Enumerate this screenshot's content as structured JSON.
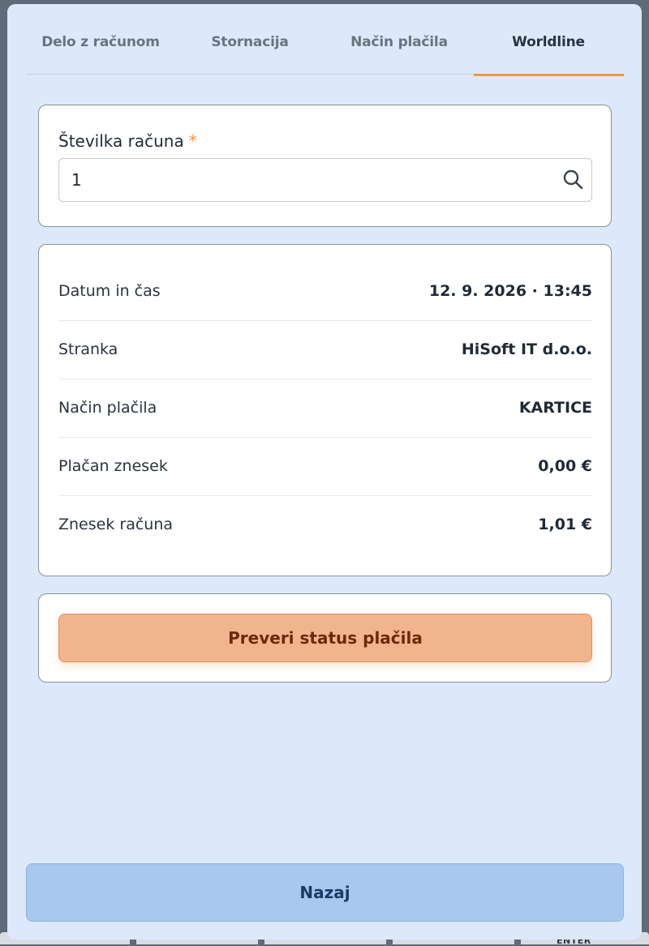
{
  "tabs": [
    {
      "label": "Delo z računom"
    },
    {
      "label": "Stornacija"
    },
    {
      "label": "Način plačila"
    },
    {
      "label": "Worldline"
    }
  ],
  "invoice_field": {
    "label": "Številka računa",
    "required_mark": "*",
    "value": "1",
    "icon": "search-icon"
  },
  "details": [
    {
      "label": "Datum in čas",
      "value": "12. 9. 2026 · 13:45"
    },
    {
      "label": "Stranka",
      "value": "HiSoft IT d.o.o."
    },
    {
      "label": "Način plačila",
      "value": "KARTICE"
    },
    {
      "label": "Plačan znesek",
      "value": "0,00 €"
    },
    {
      "label": "Znesek računa",
      "value": "1,01 €"
    }
  ],
  "actions": {
    "check_status_label": "Preveri status plačila",
    "back_label": "Nazaj"
  },
  "background_keyboard": {
    "enter_label": "ENTER"
  },
  "colors": {
    "accent": "#f0963f",
    "modal_bg": "#dde9fa",
    "primary_button": "#f2b48e",
    "back_button": "#a9c8ee"
  }
}
